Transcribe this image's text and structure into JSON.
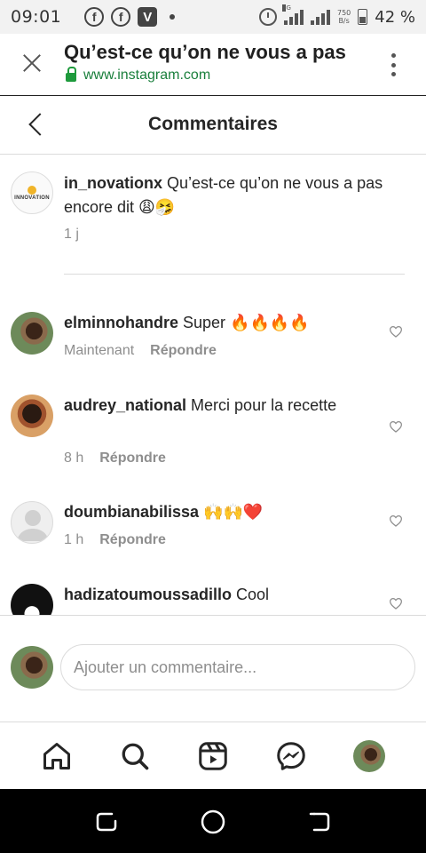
{
  "status_bar": {
    "time": "09:01",
    "network_label": "4G",
    "speed_value": "750",
    "speed_unit": "B/s",
    "battery_text": "42 %",
    "icons": [
      "facebook-icon",
      "facebook-icon",
      "v-app-icon",
      "notification-dot-icon",
      "alarm-icon",
      "signal-icon",
      "signal-icon",
      "battery-icon"
    ]
  },
  "browser": {
    "page_title": "Qu’est-ce qu’on ne vous a pas",
    "url": "www.instagram.com",
    "icons": [
      "close-icon",
      "lock-icon",
      "more-options-icon"
    ]
  },
  "header": {
    "title": "Commentaires",
    "back_icon": "back-chevron-icon"
  },
  "caption": {
    "username": "in_novationx",
    "text": " Qu’est-ce qu’on ne vous a pas encore dit 😩🤧",
    "time": "1 j",
    "logo_text": "INNOVATION"
  },
  "comments": [
    {
      "username": "elminnohandre",
      "text": " Super 🔥🔥🔥🔥",
      "time": "Maintenant",
      "reply": "Répondre"
    },
    {
      "username": "audrey_national",
      "text": " Merci pour la recette",
      "time": "8 h",
      "reply": "Répondre"
    },
    {
      "username": "doumbianabilissa",
      "text": " 🙌🙌❤️",
      "time": "1 h",
      "reply": "Répondre"
    },
    {
      "username": "hadizatoumoussadillo",
      "text": " Cool",
      "time": "",
      "reply": ""
    }
  ],
  "comment_input": {
    "placeholder": "Ajouter un commentaire..."
  },
  "bottom_nav": [
    "home-icon",
    "search-icon",
    "reels-icon",
    "messenger-icon",
    "profile-avatar"
  ],
  "system_nav": [
    "recents-icon",
    "home-circle-icon",
    "back-icon"
  ],
  "colors": {
    "accent_green": "#1a7f3c",
    "text_primary": "#262626",
    "text_secondary": "#8e8e8e",
    "divider": "#dbdbdb"
  }
}
